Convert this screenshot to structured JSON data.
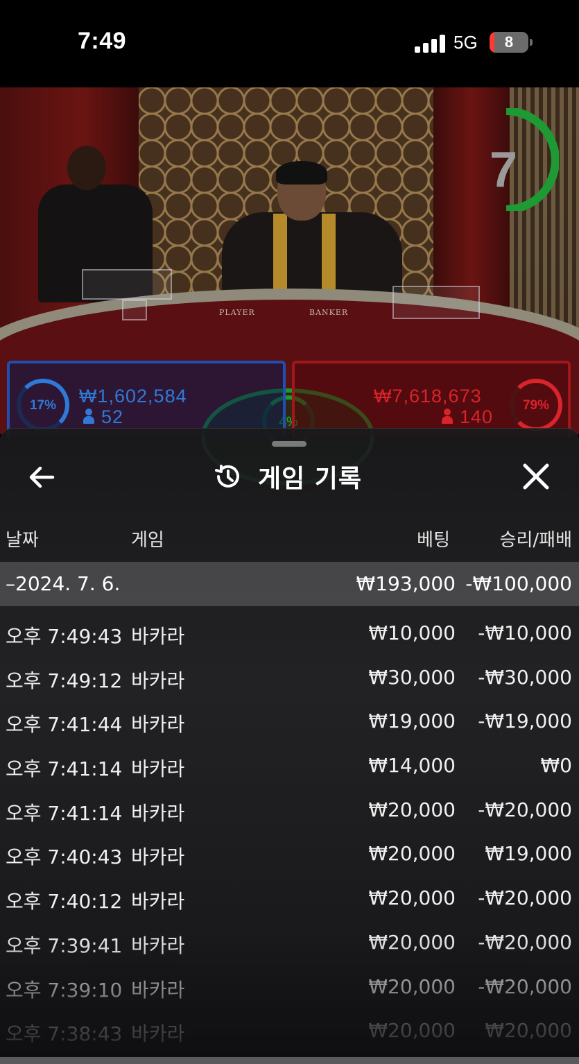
{
  "status_bar": {
    "time": "7:49",
    "network": "5G",
    "battery": "8"
  },
  "live_game": {
    "countdown": "7",
    "table_labels": {
      "player": "PLAYER",
      "banker": "BANKER"
    },
    "player": {
      "percent": "17%",
      "amount": "₩1,602,584",
      "bettors": "52",
      "color": "#2f7ad9"
    },
    "banker": {
      "percent": "79%",
      "amount": "₩7,618,673",
      "bettors": "140",
      "color": "#d8242a"
    },
    "tie": {
      "percent": "4%",
      "color": "#1d9a2d"
    }
  },
  "sheet": {
    "title": "게임 기록",
    "columns": {
      "date": "날짜",
      "game": "게임",
      "bet": "베팅",
      "result": "승리/패배"
    },
    "date_group": {
      "date": "–2024. 7. 6.",
      "bet_total": "₩193,000",
      "result_total": "-₩100,000"
    },
    "rows": [
      {
        "time": "오후 7:49:43",
        "game": "바카라",
        "bet": "₩10,000",
        "result": "-₩10,000"
      },
      {
        "time": "오후 7:49:12",
        "game": "바카라",
        "bet": "₩30,000",
        "result": "-₩30,000"
      },
      {
        "time": "오후 7:41:44",
        "game": "바카라",
        "bet": "₩19,000",
        "result": "-₩19,000"
      },
      {
        "time": "오후 7:41:14",
        "game": "바카라",
        "bet": "₩14,000",
        "result": "₩0"
      },
      {
        "time": "오후 7:41:14",
        "game": "바카라",
        "bet": "₩20,000",
        "result": "-₩20,000"
      },
      {
        "time": "오후 7:40:43",
        "game": "바카라",
        "bet": "₩20,000",
        "result": "₩19,000"
      },
      {
        "time": "오후 7:40:12",
        "game": "바카라",
        "bet": "₩20,000",
        "result": "-₩20,000"
      },
      {
        "time": "오후 7:39:41",
        "game": "바카라",
        "bet": "₩20,000",
        "result": "-₩20,000"
      },
      {
        "time": "오후 7:39:10",
        "game": "바카라",
        "bet": "₩20,000",
        "result": "-₩20,000"
      },
      {
        "time": "오후 7:38:43",
        "game": "바카라",
        "bet": "₩20,000",
        "result": "₩20,000"
      }
    ],
    "icons": {
      "back": "arrow-left-icon",
      "history": "history-clock-icon",
      "close": "close-x-icon"
    }
  }
}
